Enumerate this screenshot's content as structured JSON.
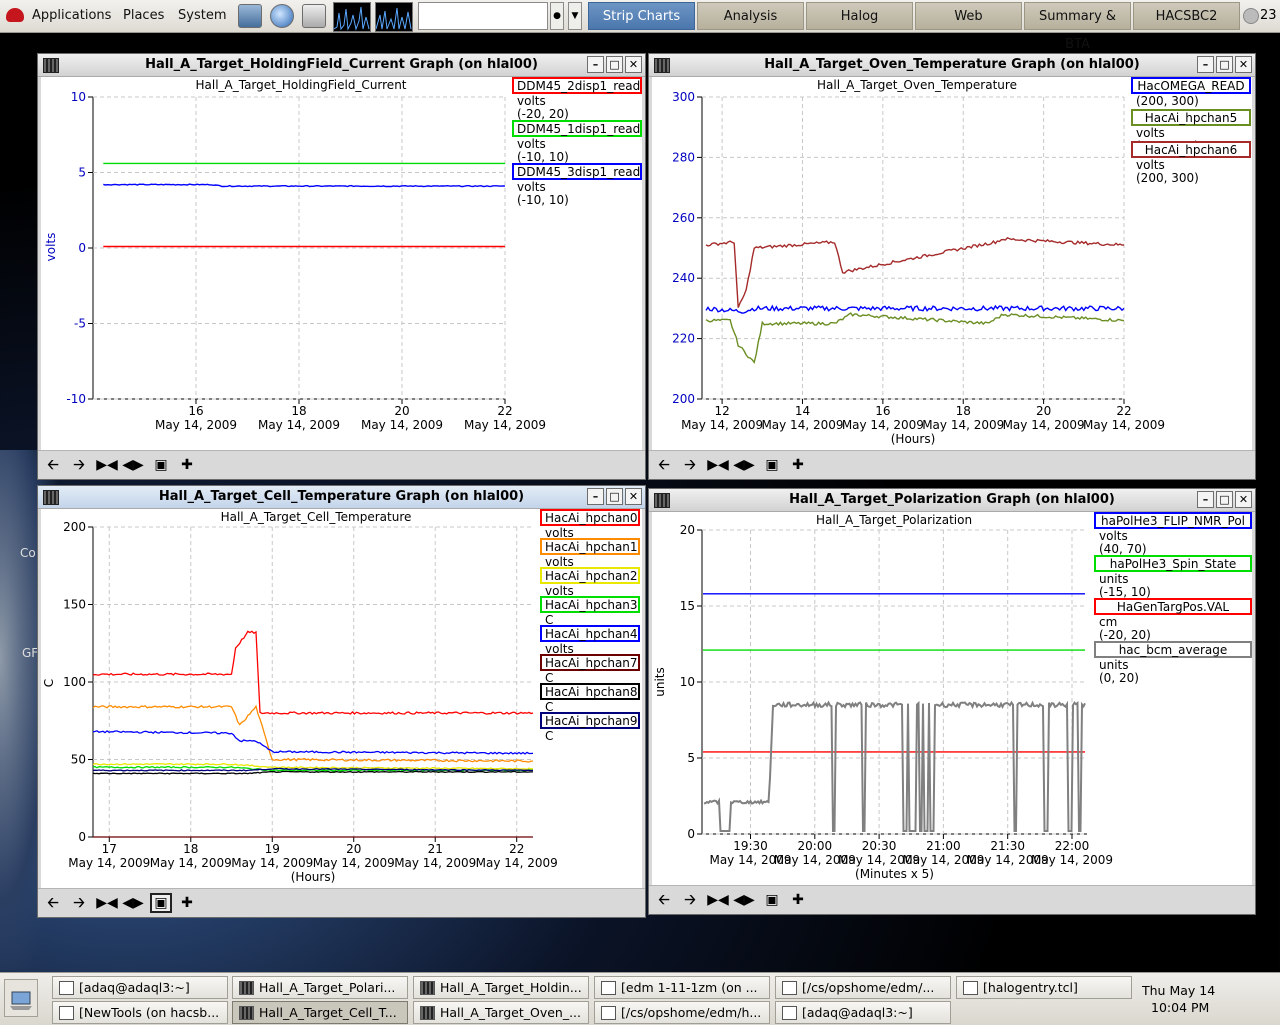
{
  "top_panel": {
    "menus": [
      "Applications",
      "Places",
      "System"
    ],
    "tabs": [
      {
        "label": "Strip Charts",
        "active": true
      },
      {
        "label": "Analysis",
        "active": false
      },
      {
        "label": "Halog",
        "active": false
      },
      {
        "label": "Web",
        "active": false
      },
      {
        "label": "Summary & BTA",
        "active": false
      },
      {
        "label": "HACSBC2",
        "active": false
      }
    ],
    "command_value": "",
    "workspace_number": "23"
  },
  "desktop_fragments": [
    "Co",
    "GF"
  ],
  "taskbar": {
    "row1": [
      "[adaq@adaql3:~]",
      "Hall_A_Target_Polari...",
      "Hall_A_Target_Holdin...",
      "[edm 1-11-1zm (on ...",
      "[/cs/opshome/edm/...",
      "[halogentry.tcl]"
    ],
    "row2": [
      "[NewTools (on hacsb...",
      "Hall_A_Target_Cell_T...",
      "Hall_A_Target_Oven_...",
      "[/cs/opshome/edm/h...",
      "[adaq@adaql3:~]"
    ],
    "clock_date": "Thu May 14",
    "clock_time": "10:04 PM"
  },
  "windows": {
    "holding": {
      "title": "Hall_A_Target_HoldingField_Current Graph (on hlal00)",
      "chart_title": "Hall_A_Target_HoldingField_Current",
      "ylabel": "volts",
      "xlabel": "",
      "yticks": [
        "10",
        "5",
        "0",
        "-5",
        "-10"
      ],
      "xticks": [
        "16",
        "18",
        "20",
        "22"
      ],
      "xdate": "May 14, 2009",
      "legend": [
        {
          "name": "DDM45_2disp1_read",
          "unit": "volts",
          "range": "(-20, 20)",
          "color": "#ff0000"
        },
        {
          "name": "DDM45_1disp1_read",
          "unit": "volts",
          "range": "(-10, 10)",
          "color": "#00dd00"
        },
        {
          "name": "DDM45_3disp1_read",
          "unit": "volts",
          "range": "(-10, 10)",
          "color": "#0000ff"
        }
      ]
    },
    "oven": {
      "title": "Hall_A_Target_Oven_Temperature Graph (on hlal00)",
      "chart_title": "Hall_A_Target_Oven_Temperature",
      "xlabel": "(Hours)",
      "yticks": [
        "300",
        "280",
        "260",
        "240",
        "220",
        "200"
      ],
      "xticks": [
        "12",
        "14",
        "16",
        "18",
        "20",
        "22"
      ],
      "xdate": "May 14, 2009",
      "legend": [
        {
          "name": "HacOMEGA_READ",
          "unit": "",
          "range": "(200, 300)",
          "color": "#0000ff"
        },
        {
          "name": "HacAi_hpchan5",
          "unit": "volts",
          "range": "(200, 300)",
          "color": "#6b8e23"
        },
        {
          "name": "HacAi_hpchan6",
          "unit": "volts",
          "range": "(200, 300)",
          "color": "#a52a2a"
        }
      ]
    },
    "cell": {
      "title": "Hall_A_Target_Cell_Temperature Graph (on hlal00)",
      "chart_title": "Hall_A_Target_Cell_Temperature",
      "ylabel": "C",
      "xlabel": "(Hours)",
      "yticks": [
        "200",
        "150",
        "100",
        "50",
        "0"
      ],
      "xticks": [
        "17",
        "18",
        "19",
        "20",
        "21",
        "22"
      ],
      "xdate": "May 14, 2009",
      "legend": [
        {
          "name": "HacAi_hpchan0",
          "unit": "volts",
          "color": "#ff0000"
        },
        {
          "name": "HacAi_hpchan1",
          "unit": "volts",
          "color": "#ff8c00"
        },
        {
          "name": "HacAi_hpchan2",
          "unit": "volts",
          "color": "#e8e800"
        },
        {
          "name": "HacAi_hpchan3",
          "unit": "C",
          "color": "#00dd00"
        },
        {
          "name": "HacAi_hpchan4",
          "unit": "volts",
          "color": "#0000ff"
        },
        {
          "name": "HacAi_hpchan7",
          "unit": "C",
          "color": "#6b0000"
        },
        {
          "name": "HacAi_hpchan8",
          "unit": "C",
          "color": "#000000"
        },
        {
          "name": "HacAi_hpchan9",
          "unit": "C",
          "color": "#00007a"
        }
      ]
    },
    "pol": {
      "title": "Hall_A_Target_Polarization Graph (on hlal00)",
      "chart_title": "Hall_A_Target_Polarization",
      "ylabel": "units",
      "xlabel": "(Minutes x 5)",
      "yticks": [
        "20",
        "15",
        "10",
        "5",
        "0"
      ],
      "xticks": [
        "19:30",
        "20:00",
        "20:30",
        "21:00",
        "21:30",
        "22:00"
      ],
      "xdate": "May 14, 2009",
      "legend": [
        {
          "name": "haPolHe3_FLIP_NMR_Pol",
          "unit": "volts",
          "range": "(40, 70)",
          "color": "#0000ff"
        },
        {
          "name": "haPolHe3_Spin_State",
          "unit": "units",
          "range": "(-15, 10)",
          "color": "#00dd00"
        },
        {
          "name": "HaGenTargPos.VAL",
          "unit": "cm",
          "range": "(-20, 20)",
          "color": "#ff0000"
        },
        {
          "name": "hac_bcm_average",
          "unit": "units",
          "range": "(0, 20)",
          "color": "#808080"
        }
      ]
    }
  },
  "chart_data": [
    {
      "type": "line",
      "title": "Hall_A_Target_HoldingField_Current",
      "ylabel": "volts",
      "xlabel": "",
      "ylim": [
        -10,
        10
      ],
      "xlim": [
        14,
        22
      ],
      "series": [
        {
          "name": "DDM45_2disp1_read",
          "x": [
            14.2,
            22.0
          ],
          "y": [
            0.1,
            0.1
          ]
        },
        {
          "name": "DDM45_1disp1_read",
          "x": [
            14.2,
            22.0
          ],
          "y": [
            5.6,
            5.6
          ]
        },
        {
          "name": "DDM45_3disp1_read",
          "x": [
            14.2,
            16.3,
            16.5,
            22.0
          ],
          "y": [
            4.2,
            4.2,
            4.1,
            4.1
          ]
        }
      ]
    },
    {
      "type": "line",
      "title": "Hall_A_Target_Oven_Temperature",
      "xlabel": "(Hours)",
      "ylim": [
        200,
        300
      ],
      "xlim": [
        11.5,
        22
      ],
      "series": [
        {
          "name": "HacOMEGA_READ",
          "x": [
            11.6,
            12.5,
            12.8,
            15,
            18,
            22
          ],
          "y": [
            230,
            229,
            230,
            230,
            230,
            230
          ]
        },
        {
          "name": "HacAi_hpchan5",
          "x": [
            11.6,
            12.2,
            12.4,
            12.8,
            13,
            14.8,
            15.2,
            18.6,
            19,
            22
          ],
          "y": [
            226,
            226,
            218,
            212,
            225,
            225,
            228,
            225,
            228,
            226
          ]
        },
        {
          "name": "HacAi_hpchan6",
          "x": [
            11.6,
            12.3,
            12.4,
            12.6,
            12.8,
            14.8,
            15,
            18.8,
            19,
            22
          ],
          "y": [
            251,
            252,
            230,
            236,
            250,
            252,
            242,
            252,
            253,
            251
          ]
        }
      ]
    },
    {
      "type": "line",
      "title": "Hall_A_Target_Cell_Temperature",
      "ylabel": "C",
      "xlabel": "(Hours)",
      "ylim": [
        0,
        200
      ],
      "xlim": [
        16.8,
        22.2
      ],
      "series": [
        {
          "name": "HacAi_hpchan0",
          "x": [
            16.8,
            18.5,
            18.55,
            18.7,
            18.8,
            18.85,
            22.2
          ],
          "y": [
            105,
            105,
            122,
            132,
            132,
            80,
            80
          ]
        },
        {
          "name": "HacAi_hpchan1",
          "x": [
            16.8,
            18.5,
            18.6,
            18.8,
            19,
            22.2
          ],
          "y": [
            84,
            84,
            72,
            84,
            50,
            49
          ]
        },
        {
          "name": "HacAi_hpchan2",
          "x": [
            16.8,
            18.5,
            19,
            22.2
          ],
          "y": [
            47,
            47,
            45,
            44
          ]
        },
        {
          "name": "HacAi_hpchan3",
          "x": [
            16.8,
            18.5,
            19,
            22.2
          ],
          "y": [
            45,
            45,
            43,
            43
          ]
        },
        {
          "name": "HacAi_hpchan4",
          "x": [
            16.8,
            18.5,
            18.6,
            18.8,
            19,
            22.2
          ],
          "y": [
            68,
            67,
            62,
            62,
            55,
            54
          ]
        },
        {
          "name": "HacAi_hpchan7",
          "x": [
            16.8,
            22.2
          ],
          "y": [
            0,
            0
          ]
        },
        {
          "name": "HacAi_hpchan8",
          "x": [
            16.8,
            18.7,
            19,
            22.2
          ],
          "y": [
            41,
            41,
            42,
            42
          ]
        },
        {
          "name": "HacAi_hpchan9",
          "x": [
            16.8,
            18.7,
            19,
            22.2
          ],
          "y": [
            43,
            43,
            44,
            43
          ]
        }
      ]
    },
    {
      "type": "line",
      "title": "Hall_A_Target_Polarization",
      "ylabel": "units",
      "xlabel": "(Minutes x 5)",
      "ylim": [
        0,
        20
      ],
      "series": [
        {
          "name": "haPolHe3_FLIP_NMR_Pol",
          "y_level": 15.8
        },
        {
          "name": "haPolHe3_Spin_State",
          "y_level": 12.1
        },
        {
          "name": "HaGenTargPos.VAL",
          "y_level": 5.4
        },
        {
          "name": "hac_bcm_average",
          "x": [
            "19:05",
            "19:30",
            "19:33",
            "22:03"
          ],
          "y": [
            2.1,
            2.1,
            8.5,
            8.5
          ]
        }
      ]
    }
  ]
}
